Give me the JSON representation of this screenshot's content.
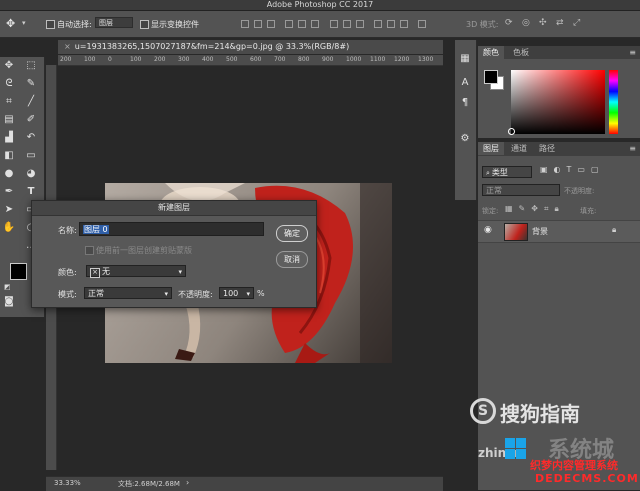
{
  "app": {
    "title": "Adobe Photoshop CC 2017"
  },
  "options_bar": {
    "auto_select_label": "自动选择:",
    "auto_select_value": "图层",
    "show_transform_label": "显示变换控件",
    "mode_3d_label": "3D 模式:"
  },
  "document": {
    "tab_title": "u=1931383265,1507027187&fm=214&gp=0.jpg @ 33.3%(RGB/8#)",
    "ruler_ticks": [
      "200",
      "100",
      "0",
      "100",
      "200",
      "300",
      "400",
      "500",
      "600",
      "700",
      "800",
      "900",
      "1000",
      "1100",
      "1200",
      "1300"
    ],
    "zoom": "33.33%",
    "doc_info": "文档:2.68M/2.68M"
  },
  "dialog": {
    "title": "新建图层",
    "name_label": "名称:",
    "name_value": "图层 0",
    "clip_label": "使用前一图层创建剪贴蒙版",
    "color_label": "颜色:",
    "color_value": "无",
    "mode_label": "模式:",
    "mode_value": "正常",
    "opacity_label": "不透明度:",
    "opacity_value": "100",
    "opacity_unit": "%",
    "ok_label": "确定",
    "cancel_label": "取消"
  },
  "color_panel": {
    "tabs": [
      "颜色",
      "色板"
    ]
  },
  "layers_panel": {
    "tabs": [
      "图层",
      "通道",
      "路径"
    ],
    "filter_label": "类型",
    "blend_mode": "正常",
    "opacity_label": "不透明度:",
    "lock_label": "锁定:",
    "fill_label": "填充:",
    "layer_name": "背景"
  },
  "watermarks": {
    "sogou": "搜狗指南",
    "sogou_sub": "zhinan",
    "site": "系统城",
    "site_cn": "织梦内容管理系统",
    "site_url": "DEDECMS.COM"
  },
  "colors": {
    "accent": "#2f5fa8",
    "panel": "#535353",
    "bg": "#282828",
    "photo_red": "#c0221c"
  }
}
